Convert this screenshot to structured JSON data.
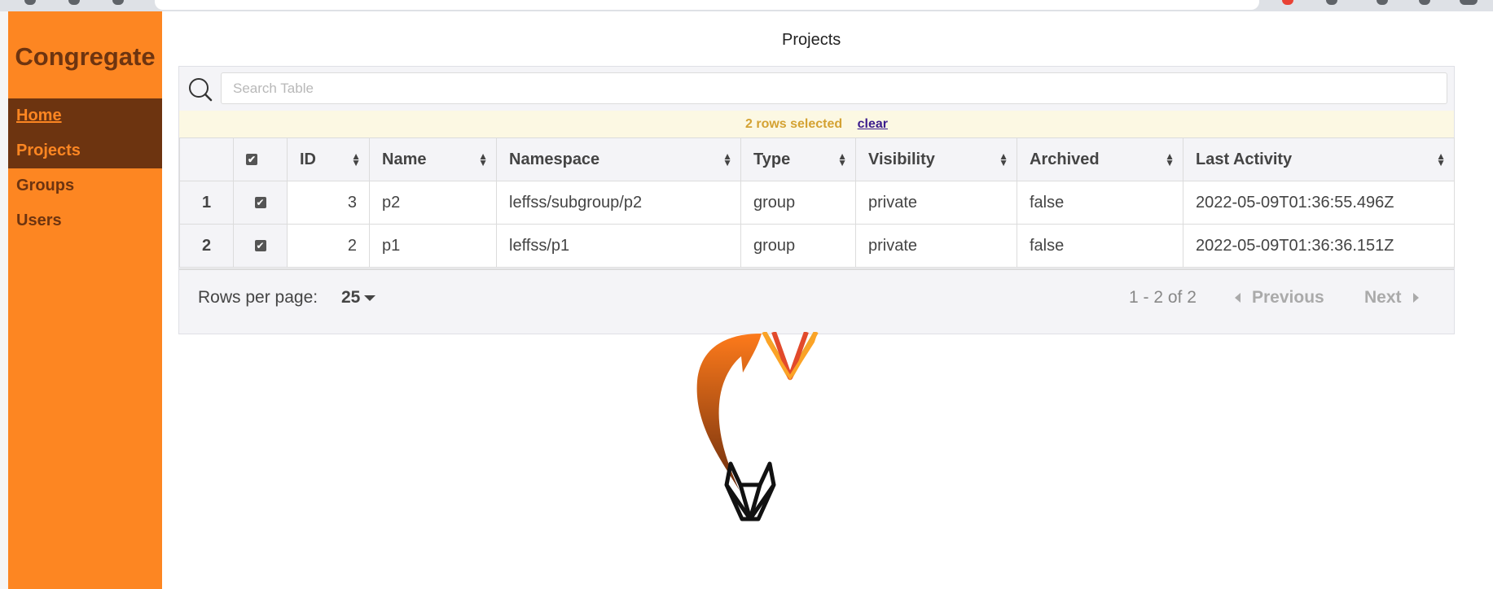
{
  "app": {
    "brand": "Congregate"
  },
  "nav": {
    "items": [
      {
        "label": "Home"
      },
      {
        "label": "Projects"
      },
      {
        "label": "Groups"
      },
      {
        "label": "Users"
      }
    ]
  },
  "page": {
    "title": "Projects"
  },
  "search": {
    "placeholder": "Search Table",
    "value": ""
  },
  "selection": {
    "text": "2 rows selected",
    "clear_label": "clear"
  },
  "table": {
    "columns": [
      "ID",
      "Name",
      "Namespace",
      "Type",
      "Visibility",
      "Archived",
      "Last Activity"
    ],
    "rows": [
      {
        "index": "1",
        "selected": true,
        "id": "3",
        "name": "p2",
        "namespace": "leffss/subgroup/p2",
        "type": "group",
        "visibility": "private",
        "archived": "false",
        "last_activity": "2022-05-09T01:36:55.496Z"
      },
      {
        "index": "2",
        "selected": true,
        "id": "2",
        "name": "p1",
        "namespace": "leffss/p1",
        "type": "group",
        "visibility": "private",
        "archived": "false",
        "last_activity": "2022-05-09T01:36:36.151Z"
      }
    ]
  },
  "pagination": {
    "rows_per_page_label": "Rows per page:",
    "rows_per_page_value": "25",
    "range_text": "1 - 2 of 2",
    "previous_label": "Previous",
    "next_label": "Next"
  },
  "colors": {
    "sidebar": "#fd8622",
    "sidebar_active": "#6d3410",
    "selection_bg": "#fcf8e3",
    "selection_text": "#d4a233"
  }
}
